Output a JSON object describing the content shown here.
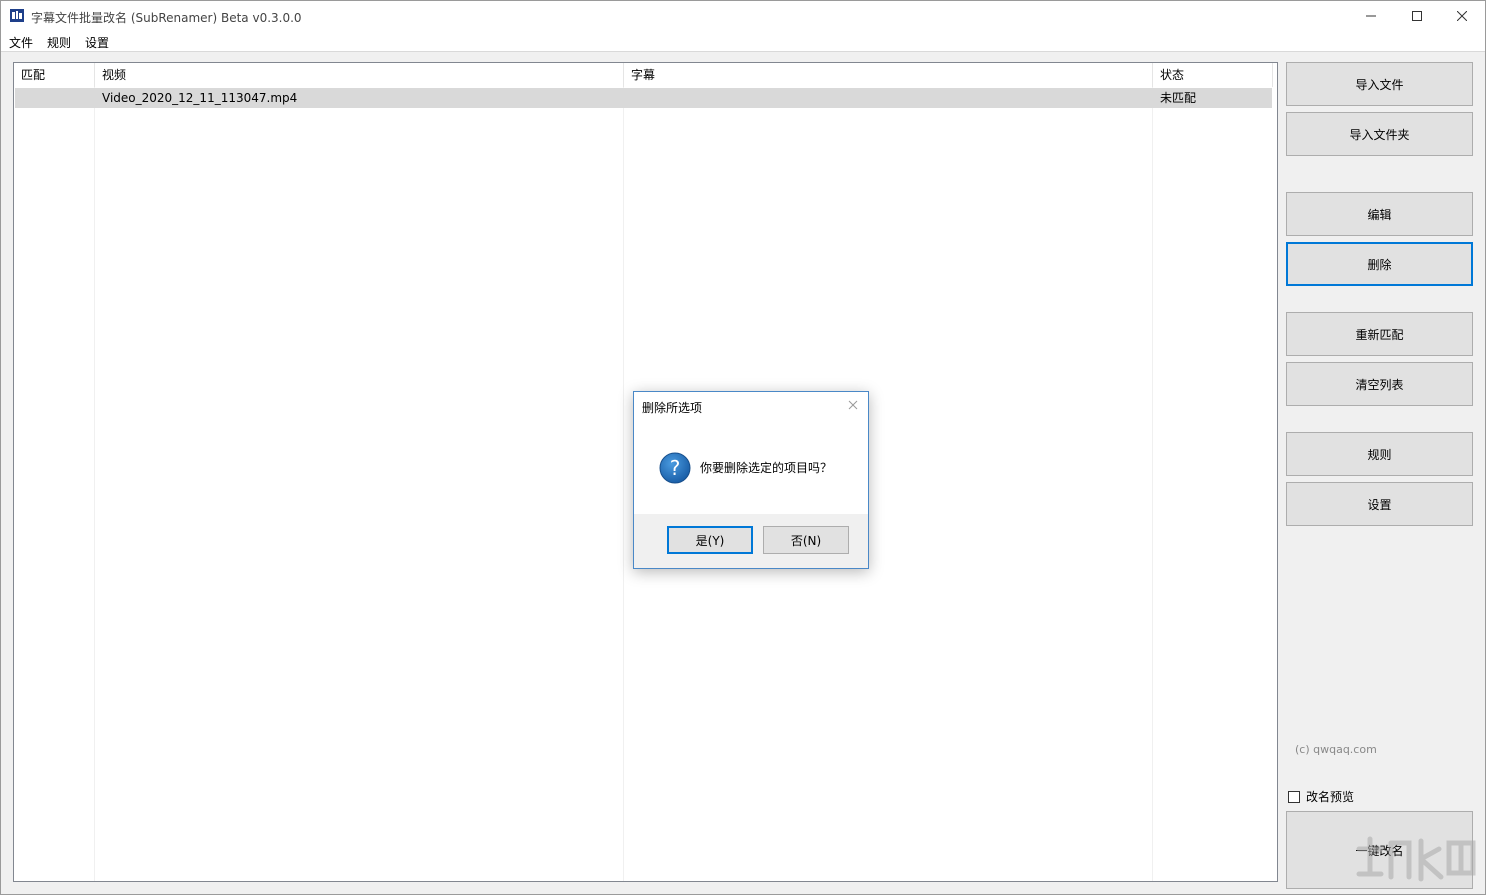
{
  "window": {
    "title": "字幕文件批量改名 (SubRenamer) Beta v0.3.0.0",
    "minimize_icon": "minimize-icon",
    "maximize_icon": "maximize-icon",
    "close_icon": "close-icon"
  },
  "menu": {
    "items": [
      {
        "label": "文件"
      },
      {
        "label": "规则"
      },
      {
        "label": "设置"
      }
    ]
  },
  "table": {
    "columns": [
      "匹配",
      "视频",
      "字幕",
      "状态"
    ],
    "rows": [
      {
        "match": "",
        "video": "Video_2020_12_11_113047.mp4",
        "subtitle": "",
        "status": "未匹配"
      }
    ]
  },
  "sidebar": {
    "import_file": "导入文件",
    "import_folder": "导入文件夹",
    "edit": "编辑",
    "delete": "删除",
    "rematch": "重新匹配",
    "clear_list": "清空列表",
    "rules": "规则",
    "settings": "设置",
    "copyright": "(c) qwqaq.com",
    "preview_label": "改名预览",
    "preview_checked": false,
    "rename_all": "一键改名"
  },
  "dialog": {
    "title": "删除所选项",
    "message": "你要删除选定的项目吗？",
    "icon": "question-icon",
    "yes_label": "是(Y)",
    "no_label": "否(N)"
  },
  "colors": {
    "accent": "#0078d7",
    "selected_row": "#d9d9d9",
    "question_icon": "#1a6fb5"
  }
}
